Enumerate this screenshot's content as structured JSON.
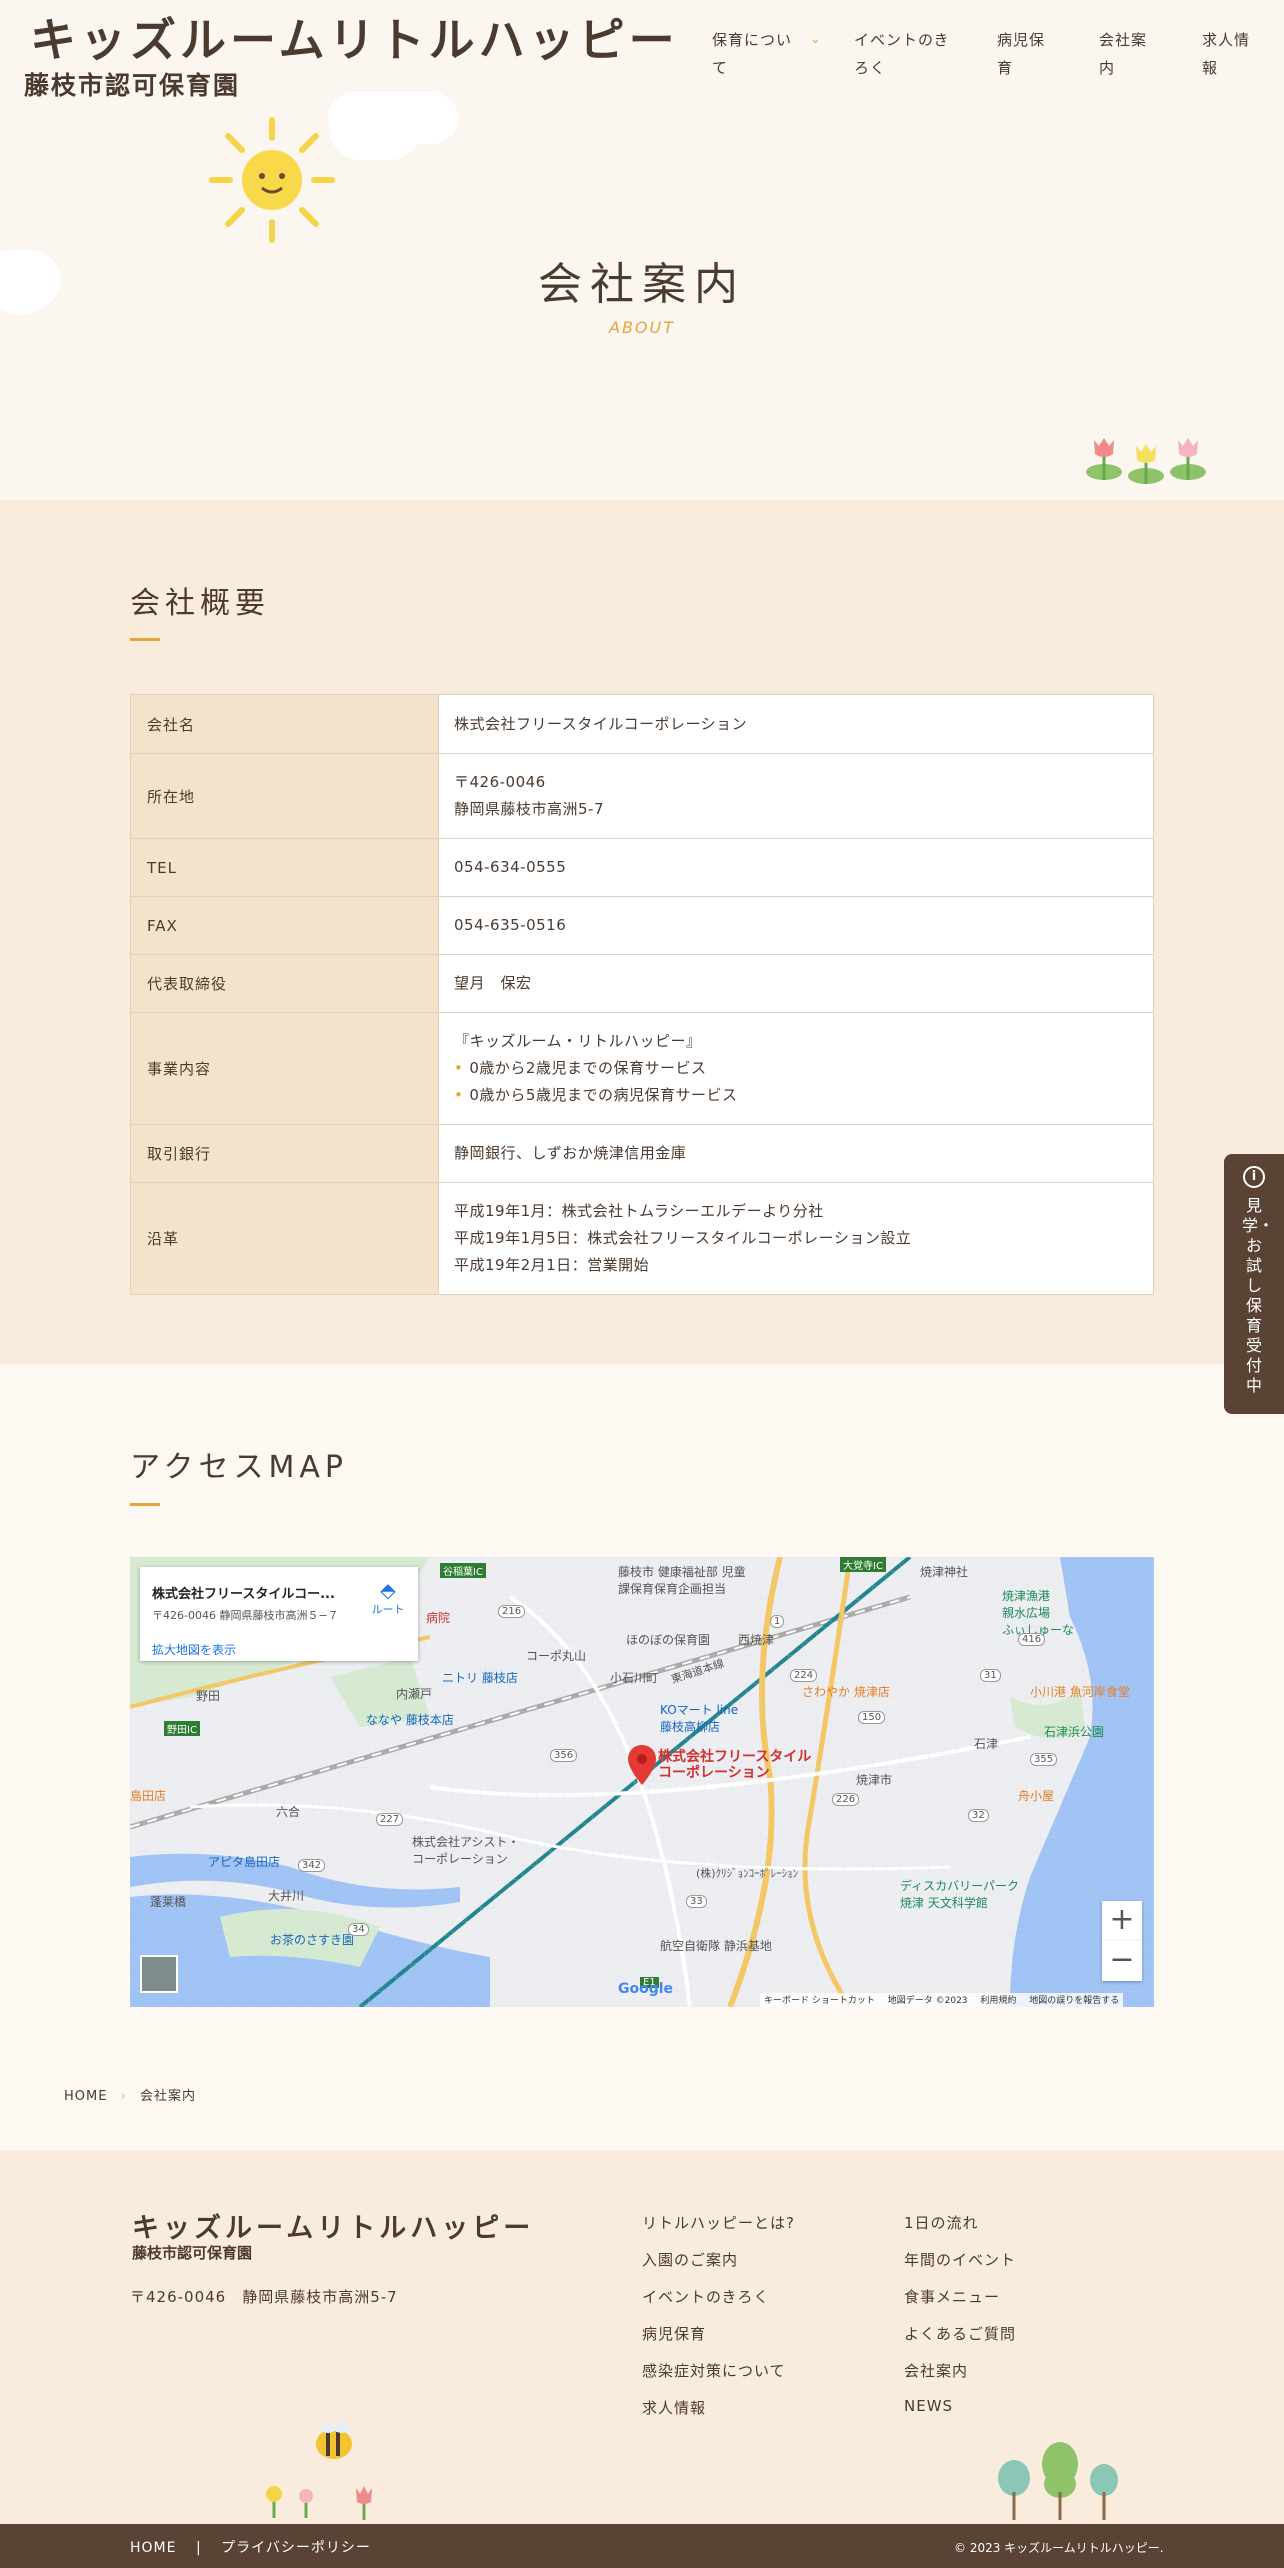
{
  "colors": {
    "accent": "#e8a33d",
    "brown": "#4b3a2f",
    "beige": "#f9ecdc",
    "table_head": "#f3e3ca"
  },
  "header": {
    "title": "キッズルームリトルハッピー",
    "subtitle": "藤枝市認可保育園",
    "nav": [
      {
        "label": "保育につい\nて",
        "has_dropdown": true
      },
      {
        "label": "イベントのき\nろく"
      },
      {
        "label": "病児保\n育"
      },
      {
        "label": "会社案\n内"
      },
      {
        "label": "求人情\n報"
      }
    ]
  },
  "page": {
    "title": "会社案内",
    "title_en": "ABOUT"
  },
  "overview": {
    "heading": "会社概要",
    "rows": [
      {
        "label": "会社名",
        "value": "株式会社フリースタイルコーポレーション"
      },
      {
        "label": "所在地",
        "lines": [
          "〒426-0046",
          "静岡県藤枝市高洲5-7"
        ]
      },
      {
        "label": "TEL",
        "value": "054-634-0555"
      },
      {
        "label": "FAX",
        "value": "054-635-0516"
      },
      {
        "label": "代表取締役",
        "value": "望月　保宏"
      },
      {
        "label": "事業内容",
        "intro": "『キッズルーム・リトルハッピー』",
        "bullets": [
          "0歳から2歳児までの保育サービス",
          "0歳から5歳児までの病児保育サービス"
        ]
      },
      {
        "label": "取引銀行",
        "value": "静岡銀行、しずおか焼津信用金庫"
      },
      {
        "label": "沿革",
        "lines": [
          "平成19年1月：株式会社トムラシーエルデーより分社",
          "平成19年1月5日：株式会社フリースタイルコーポレーション設立",
          "平成19年2月1日：営業開始"
        ]
      }
    ]
  },
  "access": {
    "heading": "アクセスMAP",
    "map": {
      "card_title": "株式会社フリースタイルコー...",
      "card_address": "〒426-0046 静岡県藤枝市高洲５−７",
      "card_link": "拡大地図を表示",
      "route_label": "ルート",
      "marker_label": "株式会社フリースタイル\nコーポレーション",
      "zoom_in": "+",
      "zoom_out": "−",
      "google": "Google",
      "attribution": [
        "キーボード ショートカット",
        "地図データ ©2023",
        "利用規約",
        "地図の誤りを報告する"
      ],
      "labels": {
        "l1": "藤枝市 健康福祉部 児童\n課保育保育企画担当",
        "l2": "焼津神社",
        "l3": "焼津漁港\n親水広場\nふぃしゅーな",
        "l4": "ほのぼの保育園",
        "l5": "西焼津",
        "l6": "コーポ丸山",
        "l7": "小石川町",
        "l8": "ニトリ 藤枝店",
        "l9": "ななや 藤枝本店",
        "l10": "KOマート line\n藤枝高柳店",
        "l11": "さわやか 焼津店",
        "l12": "小川港 魚河岸食堂",
        "l13": "石津浜公園",
        "l14": "石津",
        "l15": "焼津市",
        "l16": "舟小屋",
        "l17": "野田",
        "l18": "内瀬戸",
        "l19": "六合",
        "l20": "アピタ島田店",
        "l21": "株式会社アシスト・\nコーポレーション",
        "l22": "ディスカバリーパーク\n焼津 天文科学館",
        "l23": "大井川",
        "l24": "蓬莱橋",
        "l25": "お茶のさすき園",
        "l26": "航空自衛隊 静浜基地",
        "l27": "(株)ｸﾘｼﾞｮﾝｺｰﾎﾟﾚｰｼｮﾝ",
        "l28": "島田店",
        "l29": "東海道本線",
        "l30": "野田IC",
        "l31": "大覚寺IC",
        "l32": "谷稲葉IC",
        "l33": "病院"
      },
      "roads": [
        "416",
        "216",
        "224",
        "356",
        "150",
        "227",
        "342",
        "34",
        "33",
        "1",
        "31",
        "226",
        "355",
        "E1",
        "32"
      ]
    }
  },
  "breadcrumb": {
    "home": "HOME",
    "sep": "›",
    "current": "会社案内"
  },
  "footer": {
    "title": "キッズルームリトルハッピー",
    "subtitle": "藤枝市認可保育園",
    "address": "〒426-0046　静岡県藤枝市高洲5-7",
    "links_col1": [
      "リトルハッピーとは?",
      "入園のご案内",
      "イベントのきろく",
      "病児保育",
      "感染症対策について",
      "求人情報"
    ],
    "links_col2": [
      "1日の流れ",
      "年間のイベント",
      "食事メニュー",
      "よくあるご質問",
      "会社案内",
      "NEWS"
    ],
    "bottom_links": [
      "HOME",
      "プライバシーポリシー"
    ],
    "bottom_sep": "|",
    "copyright": "© 2023 キッズルームリトルハッピー."
  },
  "side_tab": {
    "label": "見学・お試し保育受付中"
  }
}
